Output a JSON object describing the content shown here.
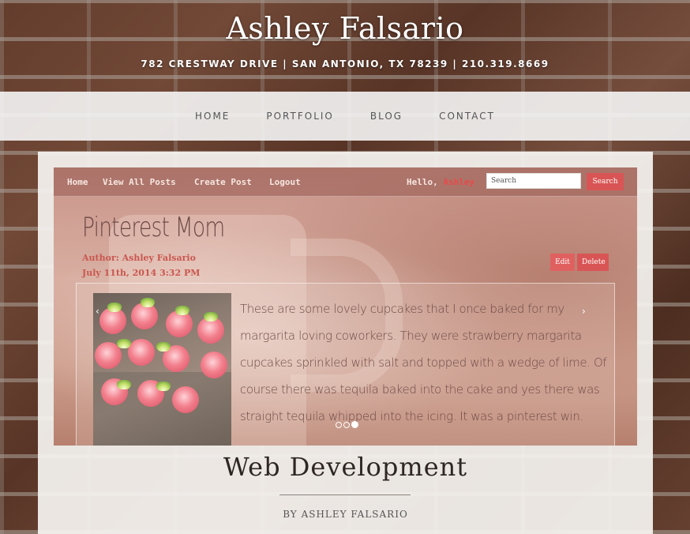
{
  "header": {
    "title": "Ashley Falsario",
    "address": "782 CRESTWAY DRIVE | SAN ANTONIO, TX 78239 | 210.319.8669"
  },
  "nav": {
    "items": [
      {
        "label": "HOME"
      },
      {
        "label": "PORTFOLIO"
      },
      {
        "label": "BLOG"
      },
      {
        "label": "CONTACT"
      }
    ]
  },
  "project": {
    "screenshot": {
      "nav_links": [
        "Home",
        "View All Posts",
        "Create Post",
        "Logout"
      ],
      "hello_prefix": "Hello,",
      "hello_name": "Ashley",
      "search_placeholder": "Search",
      "search_button": "Search",
      "post_title": "Pinterest Mom",
      "author": "Author: Ashley Falsario",
      "date": "July 11th, 2014 3:32 PM",
      "edit_label": "Edit",
      "delete_label": "Delete",
      "slide_text": "These are some lovely cupcakes that I once baked for my margarita loving coworkers. They were strawberry margarita cupcakes sprinkled with salt and topped with a wedge of lime. Of course there was tequila baked into the cake and yes there was straight tequila whipped into the icing. It was a pinterest win.",
      "arrow_prev": "‹",
      "arrow_next": "›",
      "dot_count": 3,
      "active_dot": 3,
      "icons": [
        "chevron-left-icon",
        "chevron-right-icon"
      ],
      "colors": {
        "accent": "#e84a4a",
        "button": "#d95555"
      }
    },
    "title": "Web Development",
    "byline_prefix": "BY",
    "byline_name": "ASHLEY FALSARIO"
  }
}
